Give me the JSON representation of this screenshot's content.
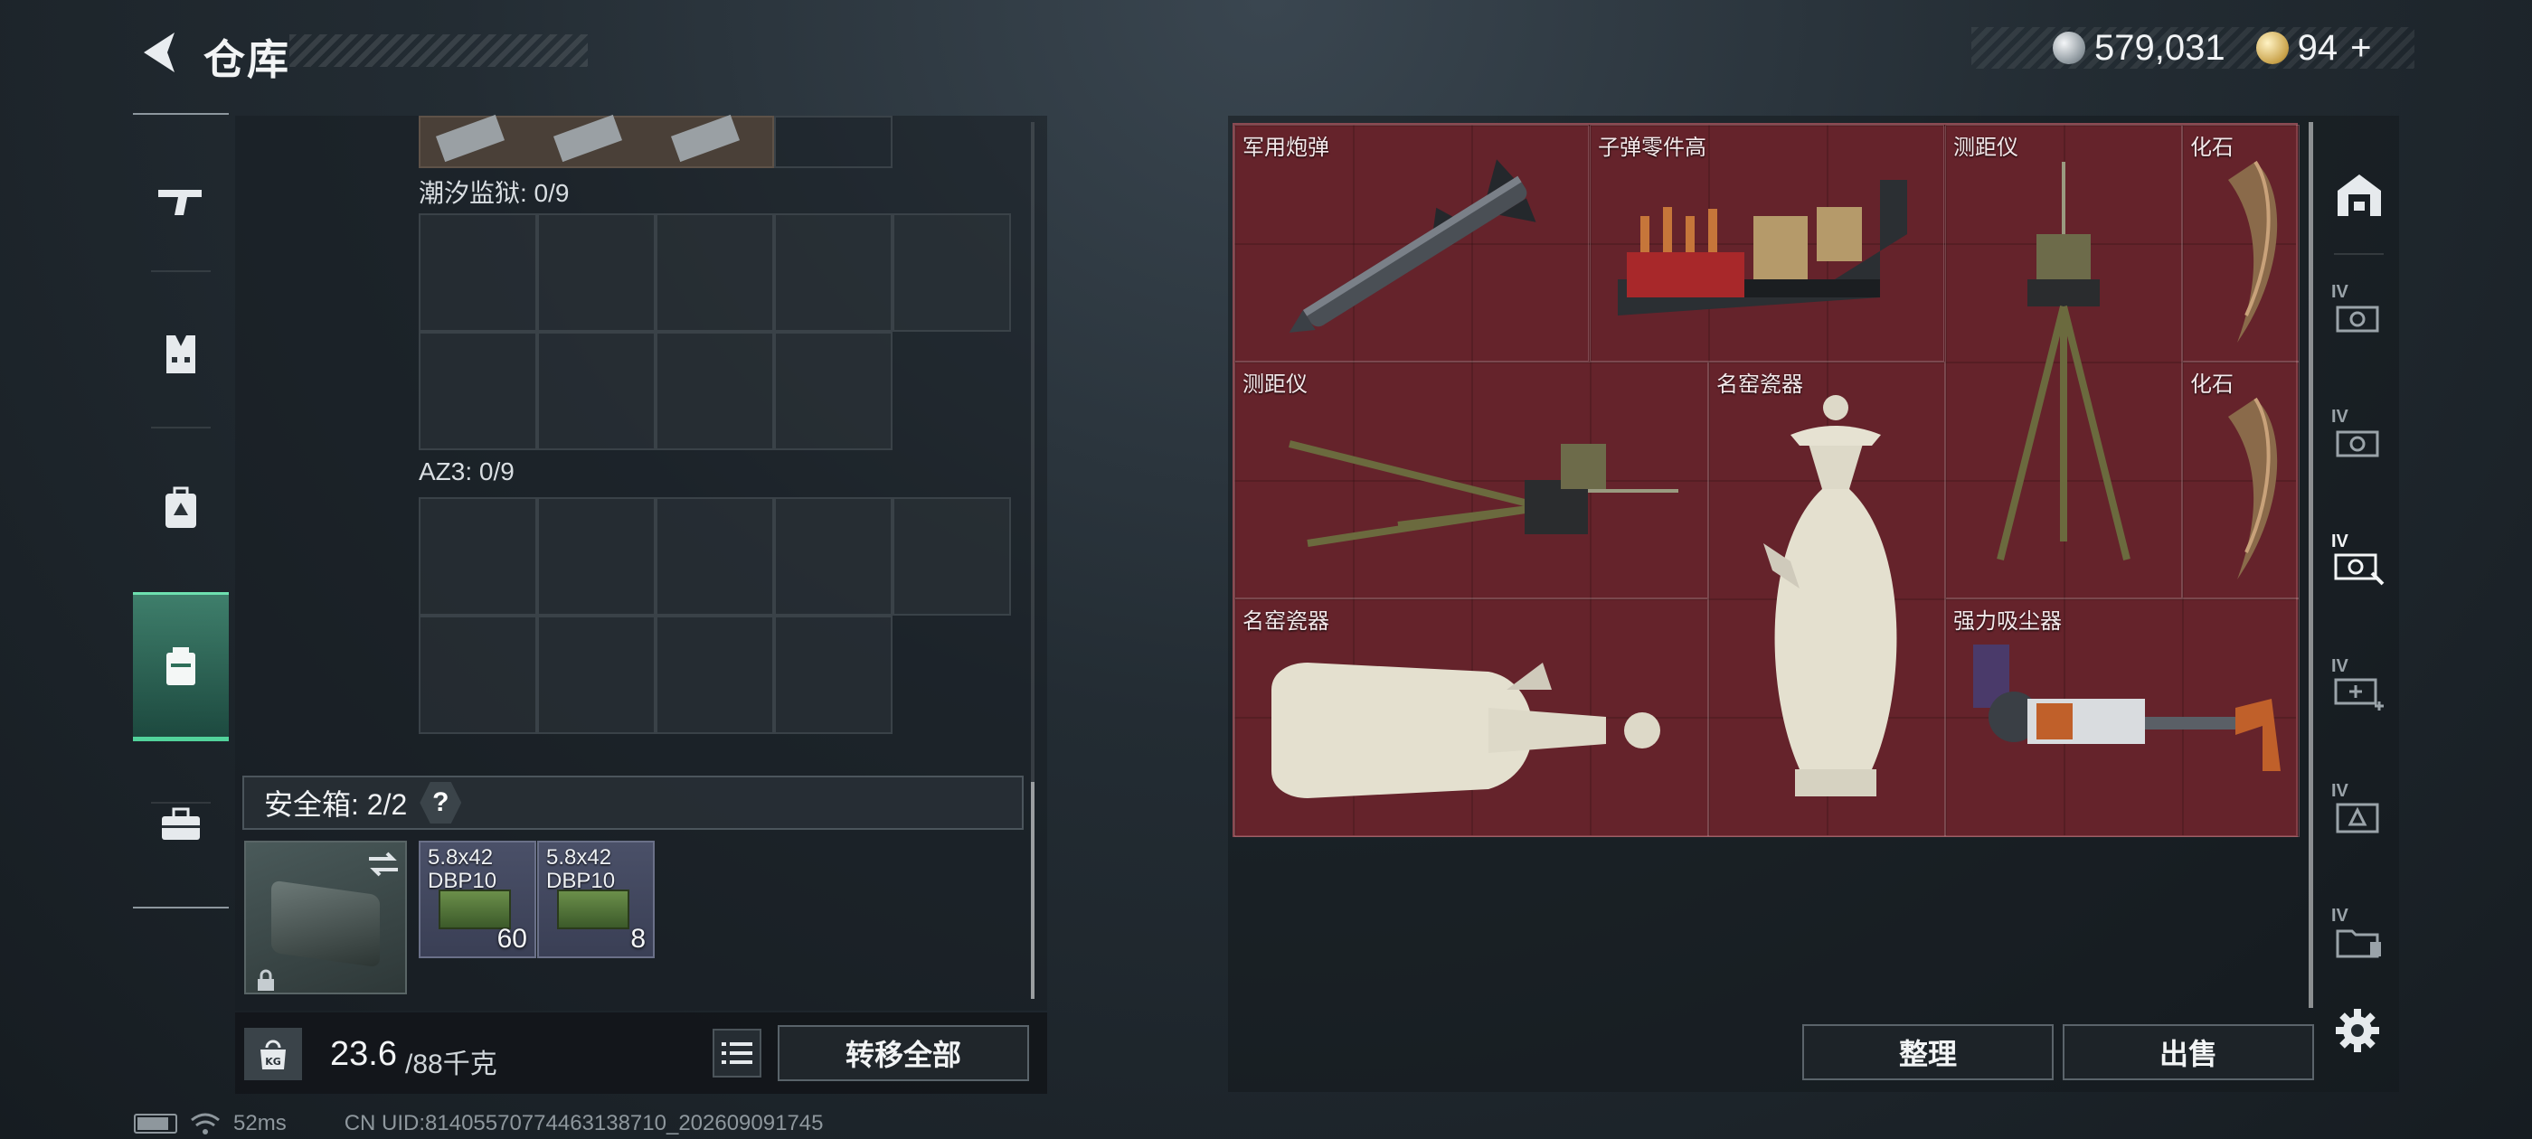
{
  "header": {
    "title": "仓库"
  },
  "currency": {
    "silver_value": "579,031",
    "gold_value": "94",
    "gold_suffix": "+"
  },
  "left_rail": {
    "items": [
      {
        "id": "weapons",
        "icon": "gun-icon"
      },
      {
        "id": "armor",
        "icon": "vest-icon"
      },
      {
        "id": "backpack",
        "icon": "backpack-icon"
      },
      {
        "id": "container",
        "icon": "container-icon",
        "active": true
      },
      {
        "id": "toolbox",
        "icon": "toolbox-icon"
      }
    ]
  },
  "backpack": {
    "sections": [
      {
        "label": "潮汐监狱: 0/9"
      },
      {
        "label": "AZ3: 0/9"
      }
    ],
    "safe_box": {
      "label": "安全箱: 2/2",
      "help": "?",
      "ammo": [
        {
          "name_line1": "5.8x42",
          "name_line2": "DBP10",
          "count": "60"
        },
        {
          "name_line1": "5.8x42",
          "name_line2": "DBP10",
          "count": "8"
        }
      ]
    }
  },
  "bottom_left": {
    "weight_current": "23.6",
    "weight_max": "/88千克",
    "weight_icon_text": "KG",
    "transfer_all_label": "转移全部"
  },
  "stash": {
    "items": [
      {
        "label": "军用炮弹"
      },
      {
        "label": "子弹零件高"
      },
      {
        "label": "测距仪"
      },
      {
        "label": "化石"
      },
      {
        "label": "测距仪"
      },
      {
        "label": "名窑瓷器"
      },
      {
        "label": "化石"
      },
      {
        "label": "名窑瓷器"
      },
      {
        "label": "强力吸尘器"
      }
    ]
  },
  "right_rail": {
    "tabs": [
      {
        "tier": "",
        "icon": "home-icon"
      },
      {
        "tier": "IV",
        "icon": "stash-tab-icon"
      },
      {
        "tier": "IV",
        "icon": "stash-tab-icon"
      },
      {
        "tier": "IV",
        "icon": "stash-tab-search-icon",
        "active": true
      },
      {
        "tier": "IV",
        "icon": "stash-tab-add-icon"
      },
      {
        "tier": "IV",
        "icon": "stash-tab-armor-icon"
      },
      {
        "tier": "IV",
        "icon": "stash-tab-folder-icon"
      }
    ]
  },
  "actions": {
    "sort_label": "整理",
    "sell_label": "出售"
  },
  "status": {
    "ping": "52ms",
    "uid": "CN UID:81405570774463138710_202609091745"
  },
  "colors": {
    "stash_bg": "#5b2128",
    "active_green": "#52d39b"
  }
}
